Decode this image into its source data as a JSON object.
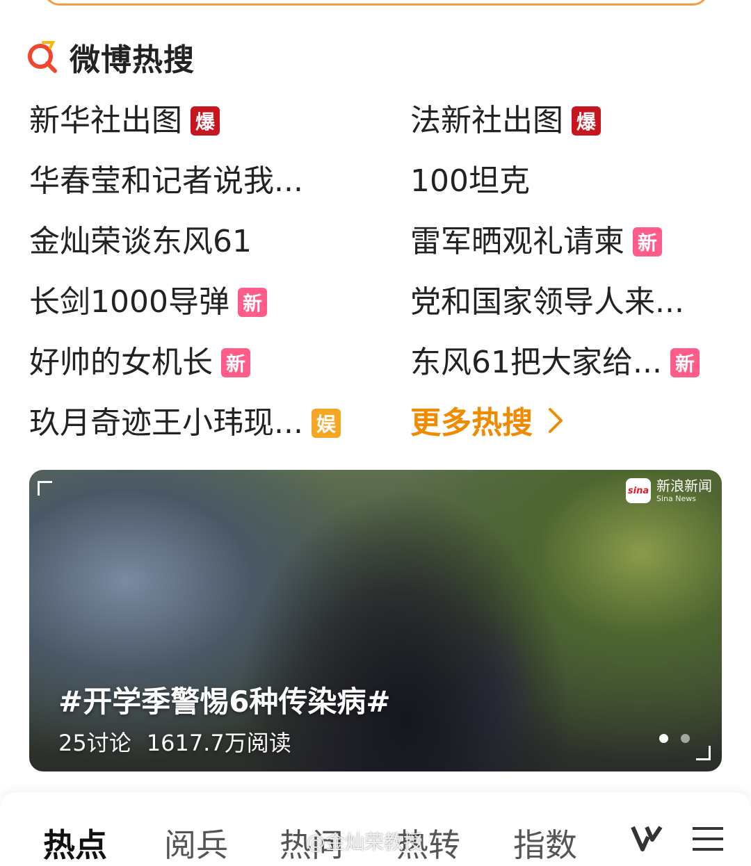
{
  "brand": {
    "title": "微博热搜"
  },
  "hot_items": [
    {
      "text": "新华社出图",
      "badge": "爆",
      "badge_color": "#c8161e"
    },
    {
      "text": "法新社出图",
      "badge": "爆",
      "badge_color": "#c8161e"
    },
    {
      "text": "华春莹和记者说我...",
      "badge": "",
      "badge_color": ""
    },
    {
      "text": "100坦克",
      "badge": "",
      "badge_color": ""
    },
    {
      "text": "金灿荣谈东风61",
      "badge": "",
      "badge_color": ""
    },
    {
      "text": "雷军晒观礼请柬",
      "badge": "新",
      "badge_color": "#ff5c8a"
    },
    {
      "text": "长剑1000导弹",
      "badge": "新",
      "badge_color": "#ff5c8a"
    },
    {
      "text": "党和国家领导人来...",
      "badge": "",
      "badge_color": ""
    },
    {
      "text": "好帅的女机长",
      "badge": "新",
      "badge_color": "#ff5c8a"
    },
    {
      "text": "东风61把大家给...",
      "badge": "新",
      "badge_color": "#ff5c8a"
    },
    {
      "text": "玖月奇迹王小玮现...",
      "badge": "娱",
      "badge_color": "#f5a623"
    }
  ],
  "more": {
    "label": "更多热搜",
    "color": "#f08a00"
  },
  "banner": {
    "source_cn": "新浪新闻",
    "source_en": "Sina News",
    "logo_text": "sina",
    "title": "#开学季警惕6种传染病#",
    "discussions": "25讨论",
    "reads": "1617.7万阅读",
    "slide_count": 2,
    "active_slide": 0
  },
  "tabs": [
    {
      "label": "热点",
      "active": true
    },
    {
      "label": "阅兵",
      "active": false
    },
    {
      "label": "热问",
      "active": false
    },
    {
      "label": "热转",
      "active": false
    },
    {
      "label": "指数",
      "active": false
    }
  ],
  "watermark": "@金灿荣教授",
  "icons": {
    "brand": "weibo-hot-search-icon",
    "chevron": "chevron-right-icon",
    "v": "v-logo-icon",
    "menu": "menu-icon"
  }
}
